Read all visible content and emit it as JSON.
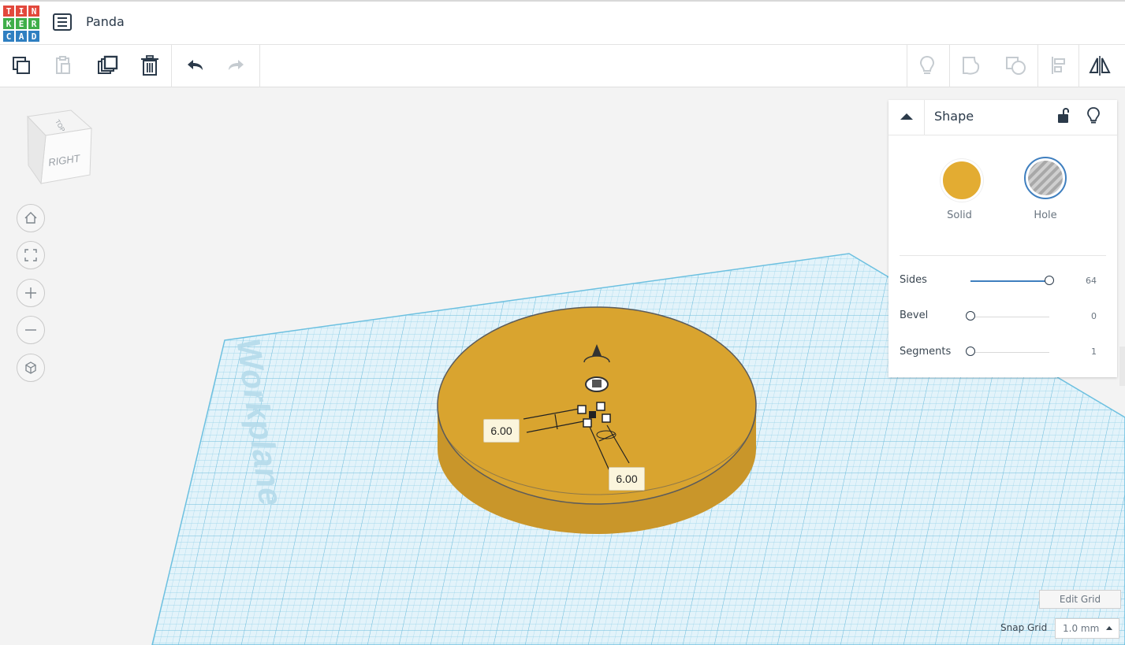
{
  "app": {
    "logo_letters": [
      "T",
      "I",
      "N",
      "K",
      "E",
      "R",
      "C",
      "A",
      "D"
    ],
    "logo_colors": [
      "#e2483c",
      "#e2483c",
      "#e2483c",
      "#3fae49",
      "#3fae49",
      "#3fae49",
      "#2f7fc1",
      "#2f7fc1",
      "#2f7fc1"
    ],
    "design_name": "Panda"
  },
  "toolbar": {
    "left_actions": [
      "copy",
      "paste",
      "duplicate",
      "delete",
      "undo",
      "redo"
    ],
    "right_actions": [
      "show-all",
      "group",
      "ungroup",
      "align",
      "mirror"
    ]
  },
  "viewcube": {
    "front_label": "RIGHT",
    "top_label": "TOP"
  },
  "nav": [
    "home",
    "fit",
    "zoom-in",
    "zoom-out",
    "perspective"
  ],
  "workplane": {
    "label": "Workplane",
    "grid_color": "#8fcfe8"
  },
  "shape_panel": {
    "title": "Shape",
    "solid_label": "Solid",
    "solid_color": "#e3ac32",
    "hole_label": "Hole",
    "properties": [
      {
        "name": "Sides",
        "value": "64",
        "fraction": 1.0
      },
      {
        "name": "Bevel",
        "value": "0",
        "fraction": 0.0
      },
      {
        "name": "Segments",
        "value": "1",
        "fraction": 0.0
      }
    ]
  },
  "dimensions": [
    {
      "value": "6.00"
    },
    {
      "value": "6.00"
    }
  ],
  "bottom_controls": {
    "edit_grid": "Edit Grid",
    "snap_grid_label": "Snap Grid",
    "snap_grid_value": "1.0 mm"
  }
}
